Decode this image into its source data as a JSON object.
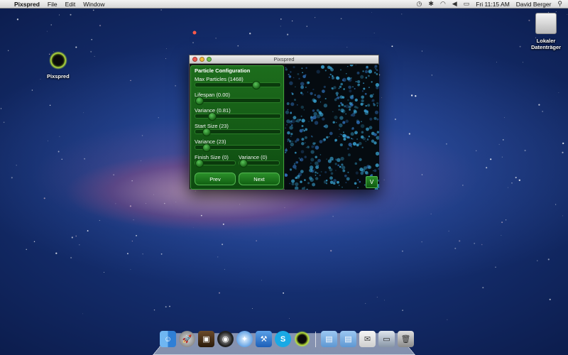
{
  "menubar": {
    "apple_glyph": "",
    "app_name": "Pixspred",
    "menus": [
      "File",
      "Edit",
      "Window"
    ],
    "clock": "Fri 11:15 AM",
    "user": "David Berger"
  },
  "desktop": {
    "app_icon_label": "Pixspred",
    "drive_label_line1": "Lokaler",
    "drive_label_line2": "Datenträger"
  },
  "window": {
    "title": "Pixspred",
    "panel_title": "Particle Configuration",
    "controls": [
      {
        "label": "Max Particles (1468)",
        "value": 0.73
      },
      {
        "label": "Lifespan (0.00)",
        "value": 0.0
      },
      {
        "label": "Variance (0.81)",
        "value": 0.16
      },
      {
        "label": "Start Size (23)",
        "value": 0.09
      },
      {
        "label": "Variance (23)",
        "value": 0.09
      }
    ],
    "finish_size": {
      "label": "Finish Size (0)",
      "value": 0.0
    },
    "finish_variance": {
      "label": "Variance (0)",
      "value": 0.0
    },
    "prev_label": "Prev",
    "next_label": "Next",
    "v_label": "V"
  },
  "colors": {
    "panel_green": "#1d6d1c",
    "accent_green": "#53b650",
    "particle_blue": "#3aa6d6"
  },
  "dock": {
    "apps": [
      "finder-icon",
      "launchpad-icon",
      "photo-booth-icon",
      "dvd-player-icon",
      "safari-icon",
      "xcode-icon",
      "skype-icon",
      "pixspred-icon"
    ],
    "stacks": [
      "applications-folder-icon",
      "documents-folder-icon",
      "mail-icon",
      "preview-icon",
      "trash-icon"
    ]
  }
}
